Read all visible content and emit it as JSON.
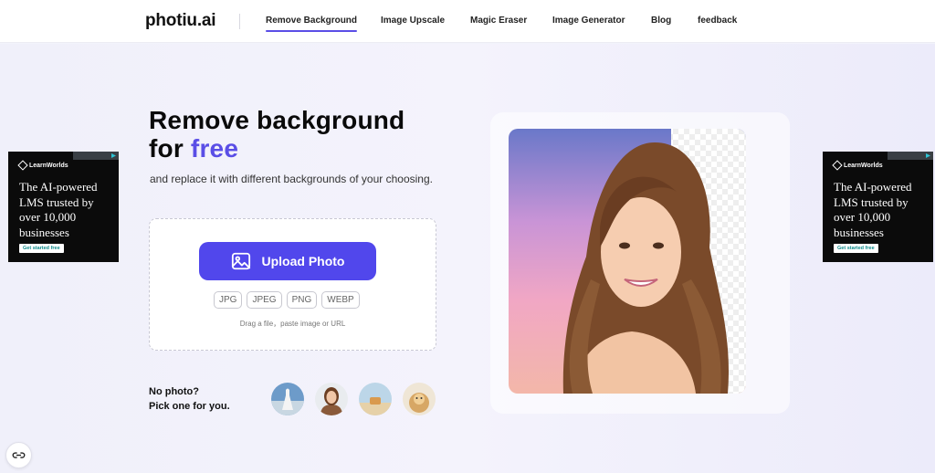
{
  "header": {
    "logo": "photiu.ai",
    "nav": [
      {
        "label": "Remove Background",
        "active": true
      },
      {
        "label": "Image Upscale"
      },
      {
        "label": "Magic Eraser"
      },
      {
        "label": "Image Generator"
      },
      {
        "label": "Blog"
      },
      {
        "label": "feedback"
      }
    ]
  },
  "hero": {
    "headline_line1": "Remove background",
    "headline_for": "for",
    "headline_accent": "free",
    "subline": "and replace it with different backgrounds of your choosing.",
    "accent_color": "#5a4ee6"
  },
  "upload": {
    "button_label": "Upload Photo",
    "button_icon": "image-icon",
    "formats": [
      "JPG",
      "JPEG",
      "PNG",
      "WEBP"
    ],
    "hint": "Drag a file，paste image or URL"
  },
  "samples": {
    "line1": "No photo?",
    "line2": "Pick one for you."
  },
  "ads": {
    "left": {
      "brand": "LearnWorlds",
      "text": "The AI-powered LMS trusted by over 10,000 businesses",
      "cta": "Get started free"
    },
    "right": {
      "brand": "LearnWorlds",
      "text": "The AI-powered LMS trusted by over 10,000 businesses",
      "cta": "Get started free"
    }
  },
  "chat_button_icon": "link-icon"
}
